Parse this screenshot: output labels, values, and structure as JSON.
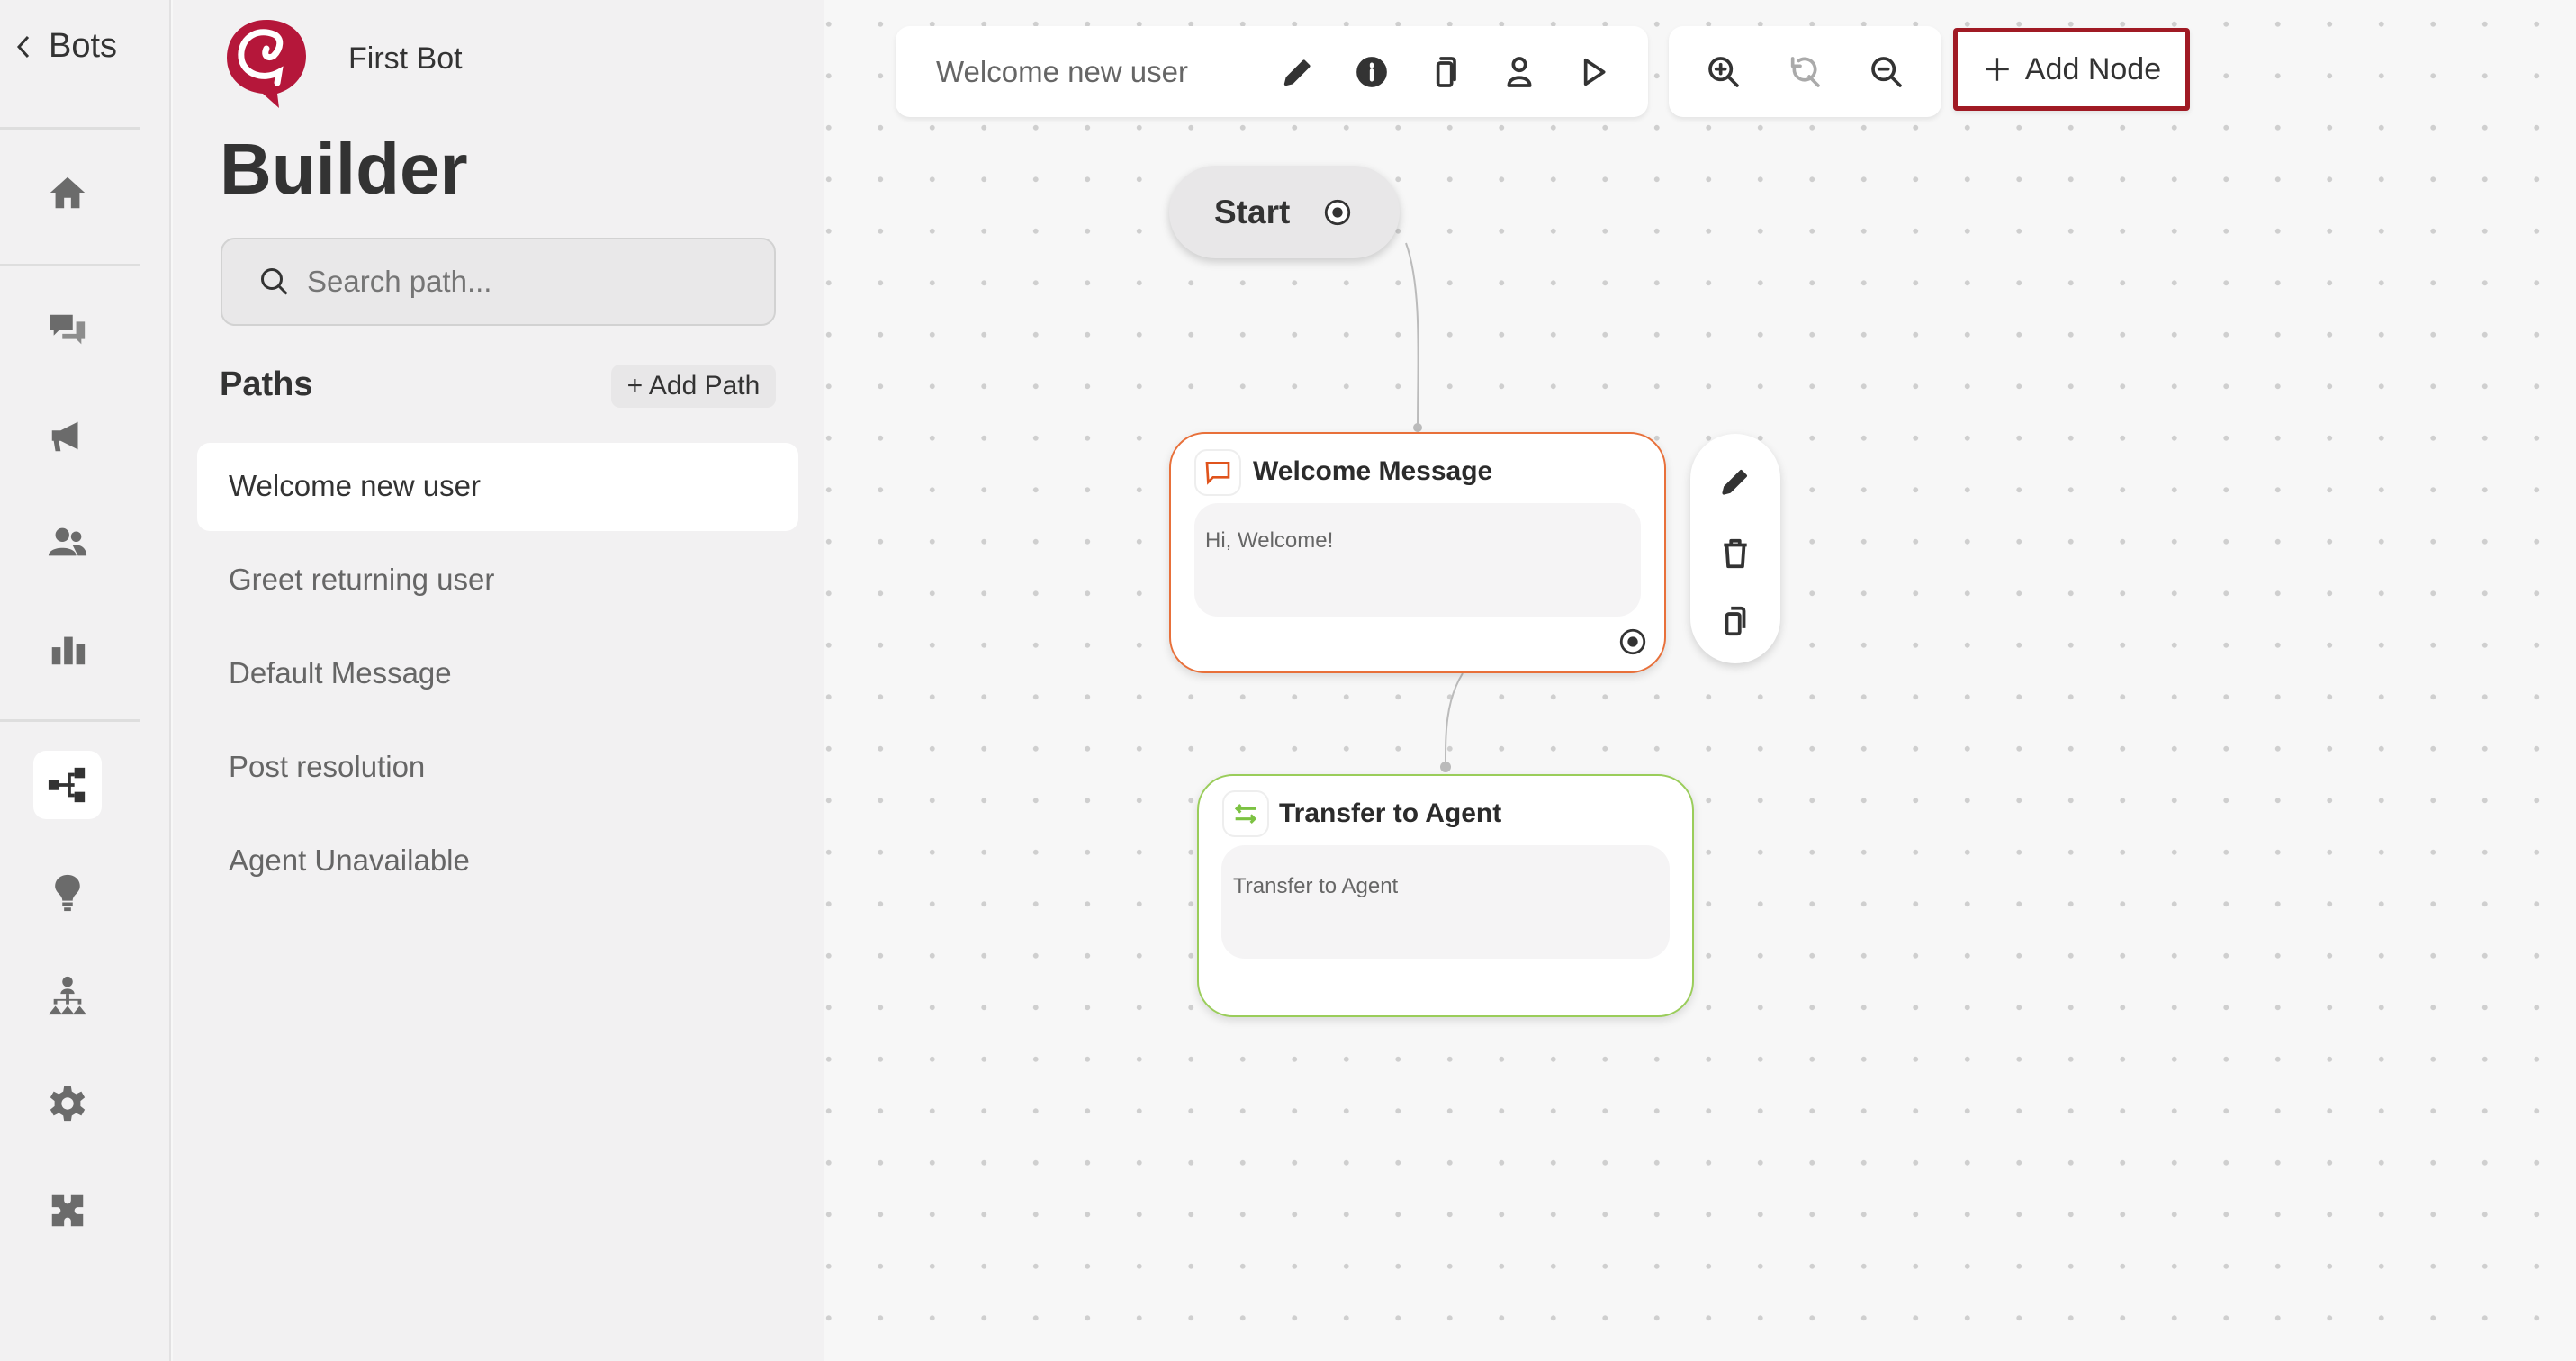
{
  "rail": {
    "back_label": "Bots",
    "items": [
      "home",
      "conversations",
      "campaigns",
      "contacts",
      "reports",
      "builder",
      "insights",
      "hierarchy",
      "settings",
      "integrations"
    ],
    "active": "builder"
  },
  "panel": {
    "bot_name": "First Bot",
    "title": "Builder",
    "search": {
      "placeholder": "Search path...",
      "value": ""
    },
    "paths_heading": "Paths",
    "add_path_label": "+ Add Path",
    "paths": [
      "Welcome new user",
      "Greet returning user",
      "Default Message",
      "Post resolution",
      "Agent Unavailable"
    ],
    "selected_path": "Welcome new user"
  },
  "toolbar": {
    "path_name": "Welcome new user",
    "icons": [
      "pencil-icon",
      "info-icon",
      "copy-icon",
      "user-icon",
      "play-icon"
    ],
    "zoom_icons": [
      "zoom-in-icon",
      "reset-icon",
      "zoom-out-icon"
    ],
    "add_node_label": "Add Node"
  },
  "flow": {
    "start_label": "Start",
    "nodes": [
      {
        "title": "Welcome Message",
        "body": "Hi, Welcome!",
        "type": "message",
        "color": "#e8703a"
      },
      {
        "title": "Transfer to Agent",
        "body": "Transfer to Agent",
        "type": "transfer",
        "color": "#9acd5a"
      }
    ],
    "node_actions": [
      "edit",
      "delete",
      "duplicate"
    ]
  },
  "colors": {
    "brand": "#b5173a",
    "highlight": "#a01a24"
  }
}
